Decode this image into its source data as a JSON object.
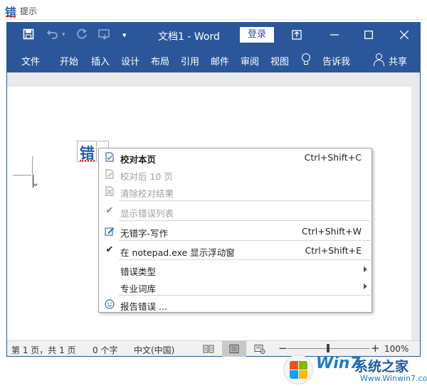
{
  "outer_window": {
    "title": "提示",
    "app_icon_char": "错"
  },
  "word": {
    "title": "文档1 - Word",
    "login_label": "登录",
    "quick_access_icons": [
      "save-icon",
      "undo-icon",
      "redo-icon",
      "touch-mode-icon",
      "customize-dropdown-icon"
    ],
    "window_controls": [
      "ribbon-display-icon",
      "minimize-icon",
      "maximize-icon",
      "close-icon"
    ],
    "ribbon_tabs": [
      "文件",
      "开始",
      "插入",
      "设计",
      "布局",
      "引用",
      "邮件",
      "审阅",
      "视图"
    ],
    "tell_me_label": "告诉我",
    "share_label": "共享",
    "theme_color": "#2b579a"
  },
  "error_badge": {
    "char": "错",
    "error_underline_color": "#e02020"
  },
  "context_menu": {
    "items": [
      {
        "icon": "proofread-page-icon",
        "label": "校对本页",
        "shortcut": "Ctrl+Shift+C",
        "bold": true,
        "disabled": false
      },
      {
        "icon": "proofread-next-icon",
        "label": "校对后 10 页",
        "shortcut": "",
        "disabled": true
      },
      {
        "icon": "clear-results-icon",
        "label": "清除校对结果",
        "shortcut": "",
        "disabled": true
      },
      {
        "icon": "check-icon",
        "label": "显示错误列表",
        "shortcut": "",
        "disabled": true,
        "checked": true
      },
      {
        "icon": "write-icon",
        "label": "无错字-写作",
        "shortcut": "Ctrl+Shift+W",
        "disabled": false
      },
      {
        "icon": "check-icon",
        "label": "在 notepad.exe 显示浮动窗",
        "shortcut": "Ctrl+Shift+E",
        "disabled": false,
        "checked": true
      },
      {
        "icon": "",
        "label": "错误类型",
        "shortcut": "",
        "submenu": true
      },
      {
        "icon": "",
        "label": "专业词库",
        "shortcut": "",
        "submenu": true
      },
      {
        "icon": "smile-icon",
        "label": "报告错误 ...",
        "shortcut": ""
      }
    ]
  },
  "status_bar": {
    "page_info": "第 1 页，共 1 页",
    "word_count": "0 个字",
    "language": "中文(中国)",
    "zoom_minus": "−",
    "zoom_plus": "+",
    "zoom_level": "100%",
    "zoom_value": 100,
    "view_modes": [
      "read-mode-icon",
      "print-layout-icon",
      "web-layout-icon"
    ],
    "active_view": "print-layout-icon"
  },
  "watermark": {
    "brand": "Win7",
    "brand_suffix": "系统之家",
    "url": "Www.Winwin7.com"
  }
}
